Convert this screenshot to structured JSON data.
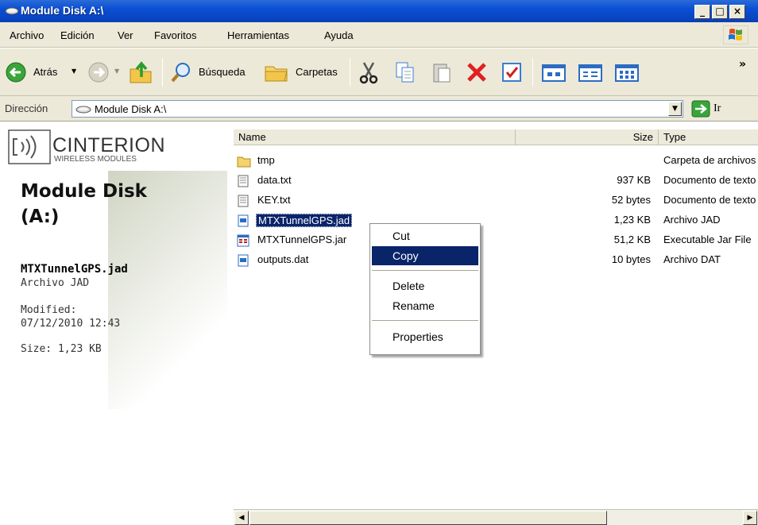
{
  "window": {
    "title": "Module Disk A:\\",
    "controls": [
      "_",
      "□",
      "×"
    ]
  },
  "menu": {
    "items": [
      "Archivo",
      "Edición",
      "Ver",
      "Favoritos",
      "Herramientas",
      "Ayuda"
    ]
  },
  "toolbar": {
    "back_label": "Atrás",
    "search_label": "Búsqueda",
    "folders_label": "Carpetas",
    "more": "»"
  },
  "address": {
    "label": "Dirección",
    "value": "Module Disk A:\\",
    "go_label": "Ir"
  },
  "left_pane": {
    "brand_name": "CINTERION",
    "brand_sub": "WIRELESS MODULES",
    "drive_title": "Module Disk (A:)",
    "selected_name": "MTXTunnelGPS.jad",
    "selected_type": "Archivo JAD",
    "modified_label": "Modified:",
    "modified_value": "07/12/2010 12:43",
    "size": "Size: 1,23 KB"
  },
  "columns": {
    "name": "Name",
    "size": "Size",
    "type": "Type"
  },
  "files": [
    {
      "name": "tmp",
      "size": "",
      "type": "Carpeta de archivos",
      "icon": "folder-icon"
    },
    {
      "name": "data.txt",
      "size": "937 KB",
      "type": "Documento de texto",
      "icon": "text-file-icon"
    },
    {
      "name": "KEY.txt",
      "size": "52 bytes",
      "type": "Documento de texto",
      "icon": "text-file-icon"
    },
    {
      "name": "MTXTunnelGPS.jad",
      "size": "1,23 KB",
      "type": "Archivo JAD",
      "icon": "jad-file-icon",
      "selected": true
    },
    {
      "name": "MTXTunnelGPS.jar",
      "size": "51,2 KB",
      "type": "Executable Jar File",
      "icon": "jar-file-icon"
    },
    {
      "name": "outputs.dat",
      "size": "10 bytes",
      "type": "Archivo DAT",
      "icon": "dat-file-icon"
    }
  ],
  "context_menu": {
    "cut": "Cut",
    "copy": "Copy",
    "delete": "Delete",
    "rename": "Rename",
    "properties": "Properties"
  },
  "colors": {
    "title_blue": "#0a4fd4",
    "selection": "#0a246a",
    "chrome": "#ece9d8"
  }
}
